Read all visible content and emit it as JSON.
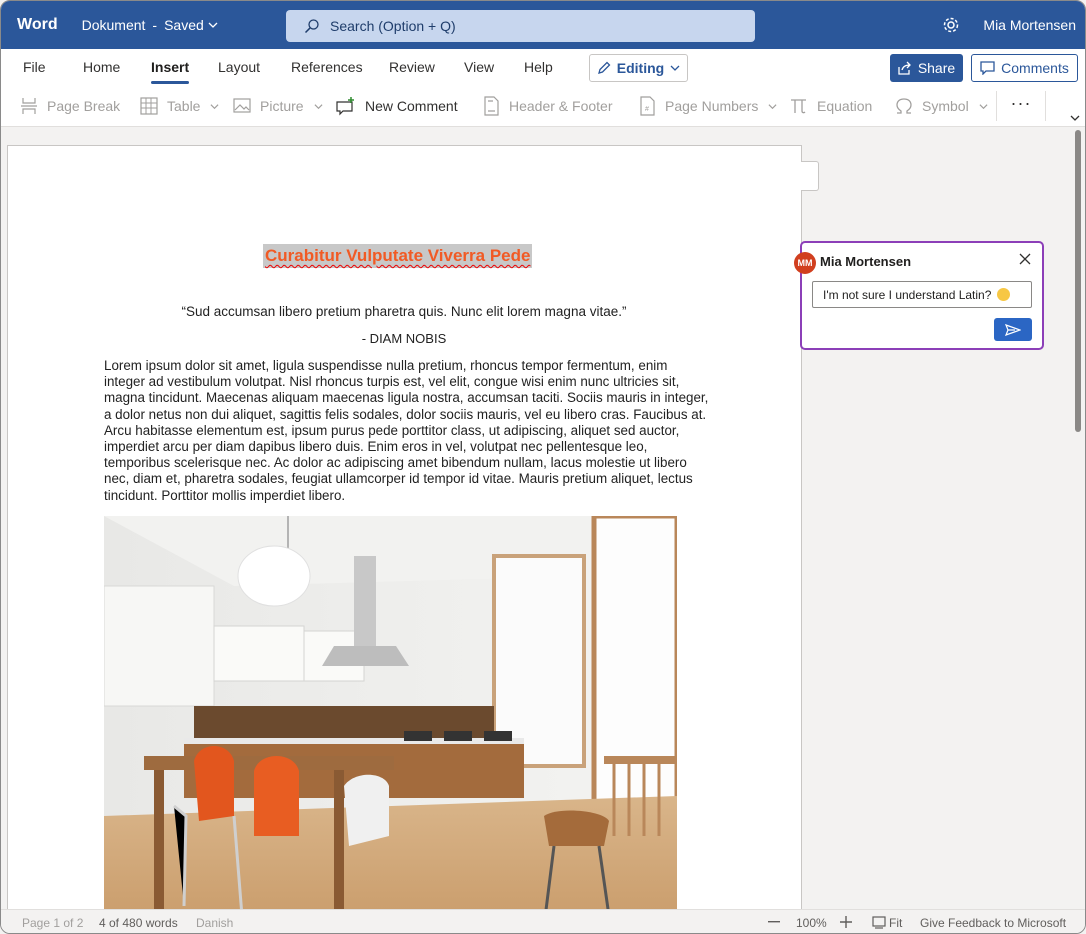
{
  "titlebar": {
    "app_name": "Word",
    "doc_name": "Dokument",
    "separator": "-",
    "save_status": "Saved",
    "search_placeholder": "Search (Option + Q)",
    "user_name": "Mia Mortensen",
    "color": "#2b579a"
  },
  "ribbon": {
    "tabs": [
      {
        "label": "File"
      },
      {
        "label": "Home"
      },
      {
        "label": "Insert",
        "active": true
      },
      {
        "label": "Layout"
      },
      {
        "label": "References"
      },
      {
        "label": "Review"
      },
      {
        "label": "View"
      },
      {
        "label": "Help"
      }
    ],
    "editing_label": "Editing",
    "share_label": "Share",
    "comments_label": "Comments",
    "tools": [
      {
        "label": "Page Break",
        "icon": "page-break-icon",
        "enabled": false
      },
      {
        "label": "Table",
        "icon": "table-icon",
        "enabled": false
      },
      {
        "label": "Picture",
        "icon": "picture-icon",
        "enabled": false
      },
      {
        "label": "New Comment",
        "icon": "new-comment-icon",
        "enabled": true
      },
      {
        "label": "Header & Footer",
        "icon": "header-footer-icon",
        "enabled": false
      },
      {
        "label": "Page Numbers",
        "icon": "page-numbers-icon",
        "enabled": false
      },
      {
        "label": "Equation",
        "icon": "equation-icon",
        "enabled": false
      },
      {
        "label": "Symbol",
        "icon": "symbol-icon",
        "enabled": false
      }
    ],
    "more_label": "···"
  },
  "document": {
    "heading": "Curabitur Vulputate Viverra Pede",
    "quote": "“Sud accumsan libero pretium pharetra quis. Nunc elit lorem magna vitae.”",
    "quote_author": "- DIAM NOBIS",
    "body": "Lorem ipsum dolor sit amet, ligula suspendisse nulla pretium, rhoncus tempor fermentum, enim integer ad vestibulum volutpat. Nisl rhoncus turpis est, vel elit, congue wisi enim nunc ultricies sit, magna tincidunt. Maecenas aliquam maecenas ligula nostra, accumsan taciti. Sociis mauris in integer, a dolor netus non dui aliquet, sagittis felis sodales, dolor sociis mauris, vel eu libero cras. Faucibus at. Arcu habitasse elementum est, ipsum purus pede porttitor class, ut adipiscing, aliquet sed auctor, imperdiet arcu per diam dapibus libero duis. Enim eros in vel, volutpat nec pellentesque leo, temporibus scelerisque nec. Ac dolor ac adipiscing amet bibendum nullam, lacus molestie ut libero nec, diam et, pharetra sodales, feugiat ullamcorper id tempor id vitae. Mauris pretium aliquet, lectus tincidunt. Porttitor mollis imperdiet libero."
  },
  "comment": {
    "author": "Mia Mortensen",
    "initials": "MM",
    "text": "I'm not sure I understand Latin?",
    "emoji": "thinking-face",
    "border_color": "#8c3fb8"
  },
  "statusbar": {
    "page": "Page 1 of 2",
    "words": "4 of 480 words",
    "language": "Danish",
    "zoom": "100%",
    "fit_label": "Fit",
    "feedback": "Give Feedback to Microsoft"
  }
}
